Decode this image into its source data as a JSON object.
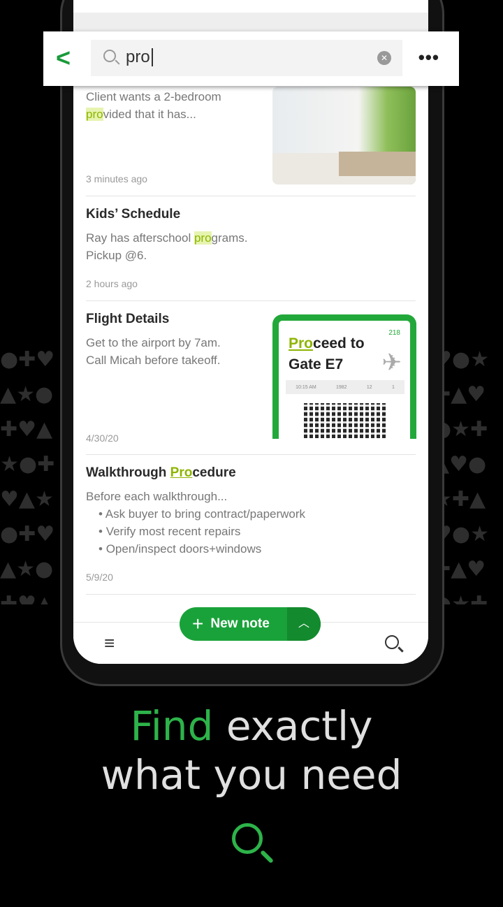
{
  "search": {
    "query": "pro"
  },
  "notes": [
    {
      "title": "",
      "body_pre": "Client wants a 2-bedroom",
      "body_hl": "pro",
      "body_post": "vided that it has...",
      "date": "3 minutes ago"
    },
    {
      "title": "Kids’ Schedule",
      "body_pre": "Ray has afterschool ",
      "body_hl": "pro",
      "body_post": "grams.",
      "body_line2": "Pickup @6.",
      "date": "2 hours ago"
    },
    {
      "title": "Flight Details",
      "body_line1": "Get to the airport by 7am.",
      "body_line2": "Call Micah before takeoff.",
      "date": "4/30/20",
      "pass": {
        "hl": "Pro",
        "rest": "ceed to",
        "line2": "Gate E7",
        "num": "218",
        "fields": [
          "10:15 AM",
          "1982",
          "12",
          "1"
        ]
      }
    },
    {
      "title_pre": "Walkthrough ",
      "title_hl": "Pro",
      "title_post": "cedure",
      "body_line1": "Before each walkthrough...",
      "bullets": [
        "Ask buyer to bring contract/paperwork",
        "Verify most recent repairs",
        "Open/inspect doors+windows"
      ],
      "date": "5/9/20"
    }
  ],
  "new_note": {
    "label": "New note"
  },
  "tagline": {
    "highlight": "Find",
    "line1_rest": " exactly",
    "line2": "what you need"
  },
  "colors": {
    "accent": "#1aa23a",
    "highlight": "#8db500"
  }
}
